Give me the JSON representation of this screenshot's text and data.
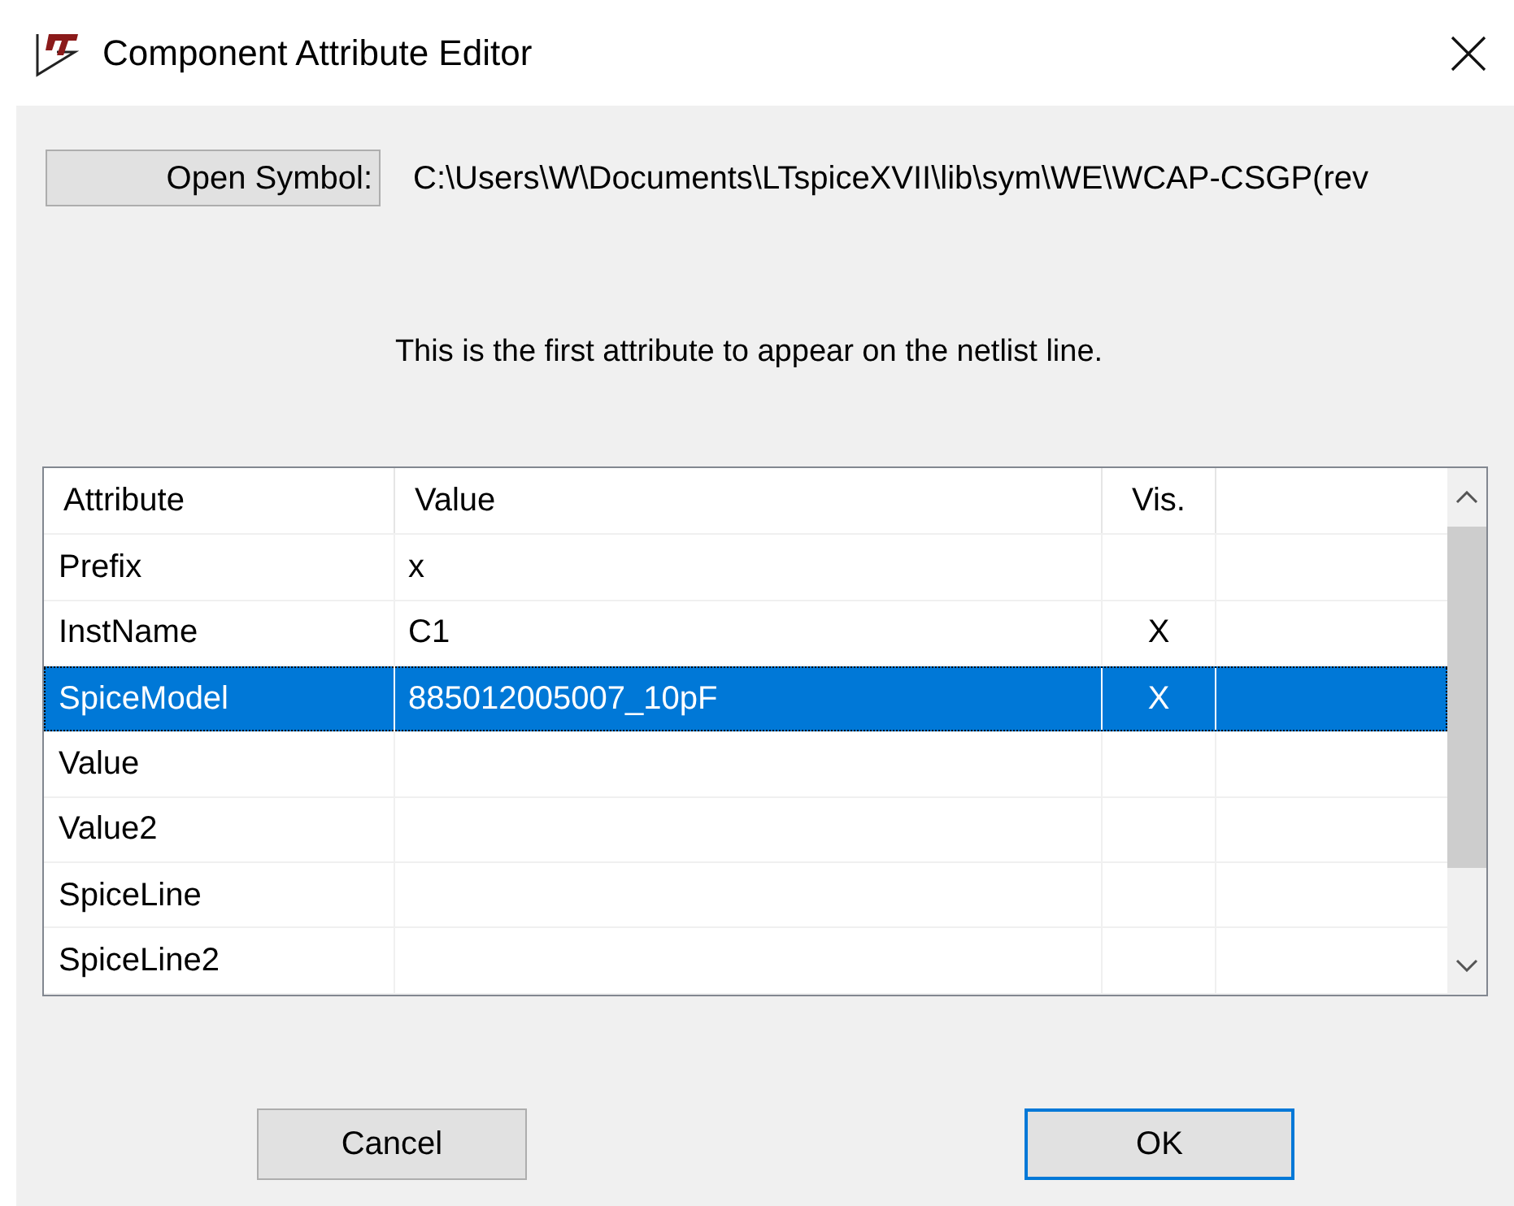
{
  "window": {
    "title": "Component Attribute Editor"
  },
  "open_symbol": {
    "label": "Open Symbol:",
    "path": "C:\\Users\\W\\Documents\\LTspiceXVII\\lib\\sym\\WE\\WCAP-CSGP(rev"
  },
  "message": "This is the first attribute to appear on the netlist line.",
  "table": {
    "columns": [
      "Attribute",
      "Value",
      "Vis."
    ],
    "rows": [
      {
        "attribute": "Prefix",
        "value": "x",
        "selected": false
      },
      {
        "attribute": "InstName",
        "value": "C1",
        "vis": "X",
        "selected": false
      },
      {
        "attribute": "SpiceModel",
        "value": "885012005007_10pF",
        "vis": "X",
        "selected": true
      },
      {
        "attribute": "Value",
        "selected": false
      },
      {
        "attribute": "Value2",
        "selected": false
      },
      {
        "attribute": "SpiceLine",
        "selected": false
      },
      {
        "attribute": "SpiceLine2",
        "selected": false
      }
    ]
  },
  "buttons": [
    {
      "label": "Cancel",
      "default": false
    },
    {
      "label": "OK",
      "default": true
    }
  ]
}
